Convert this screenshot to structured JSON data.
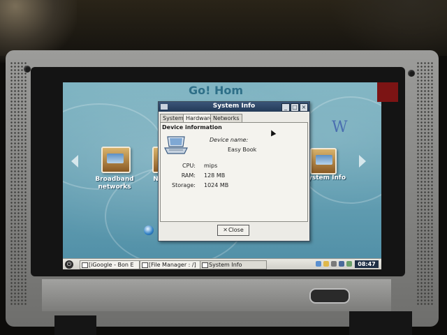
{
  "window": {
    "title": "System Info",
    "tabs": [
      "System",
      "Hardware",
      "Networks"
    ],
    "active_tab": "Hardware",
    "section_title": "Device information",
    "device_name_label": "Device name:",
    "device_name_value": "Easy Book",
    "rows": [
      {
        "label": "CPU:",
        "value": "mips"
      },
      {
        "label": "RAM:",
        "value": "128 MB"
      },
      {
        "label": "Storage:",
        "value": "1024 MB"
      }
    ],
    "close_label": "Close",
    "close_icon": "close-x-icon"
  },
  "desktop": {
    "logo_partial": "Go! Hom",
    "logo_right": "W",
    "icons": [
      {
        "label": "Broadband networks",
        "icon": "broadband-icon"
      },
      {
        "label": "N",
        "icon": "partial-icon"
      },
      {
        "label": "ystem Info",
        "icon": "system-info-icon"
      }
    ]
  },
  "taskbar": {
    "tasks": [
      {
        "label": "[iGoogle - Bon E",
        "icon": "browser-icon"
      },
      {
        "label": "[File Manager : /]",
        "icon": "folder-icon"
      },
      {
        "label": "System Info",
        "icon": "system-info-icon"
      }
    ],
    "clock": "08:47",
    "start_icon": "power-icon"
  },
  "colors": {
    "titlebar": "#2d4566",
    "desktop": "#6aa4b6",
    "clock_bg": "#1f2f45"
  }
}
